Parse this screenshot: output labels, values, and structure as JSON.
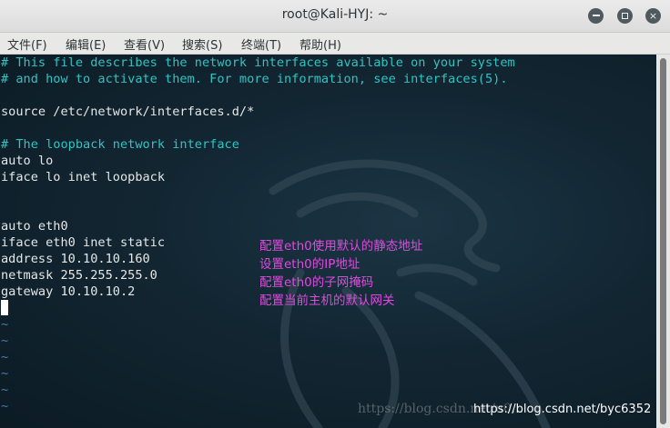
{
  "window": {
    "title": "root@Kali-HYJ: ~",
    "buttons": {
      "minimize": "minimize",
      "maximize": "maximize",
      "close": "×"
    }
  },
  "menu": {
    "items": [
      "文件(F)",
      "编辑(E)",
      "查看(V)",
      "搜索(S)",
      "终端(T)",
      "帮助(H)"
    ]
  },
  "terminal": {
    "lines": [
      "# This file describes the network interfaces available on your system",
      "# and how to activate them. For more information, see interfaces(5).",
      "",
      "source /etc/network/interfaces.d/*",
      "",
      "# The loopback network interface",
      "auto lo",
      "iface lo inet loopback",
      "",
      "",
      "auto eth0",
      "iface eth0 inet static",
      "address 10.10.10.160",
      "netmask 255.255.255.0",
      "gateway 10.10.10.2",
      "",
      "~",
      "~",
      "~",
      "~",
      "~",
      "~"
    ],
    "annotations": [
      "配置eth0使用默认的静态地址",
      "设置eth0的IP地址",
      "配置eth0的子网掩码",
      "配置当前主机的默认网关"
    ],
    "watermark": "https://blog.csdn.net/u0...",
    "watermark_overlay": "https://blog.csdn.net/byc6352"
  },
  "colors": {
    "comment": "#2ec4c4",
    "text": "#e6e6e6",
    "annotation": "#e04ae0",
    "tilde": "#3f7fb8",
    "background": "#12222c"
  }
}
